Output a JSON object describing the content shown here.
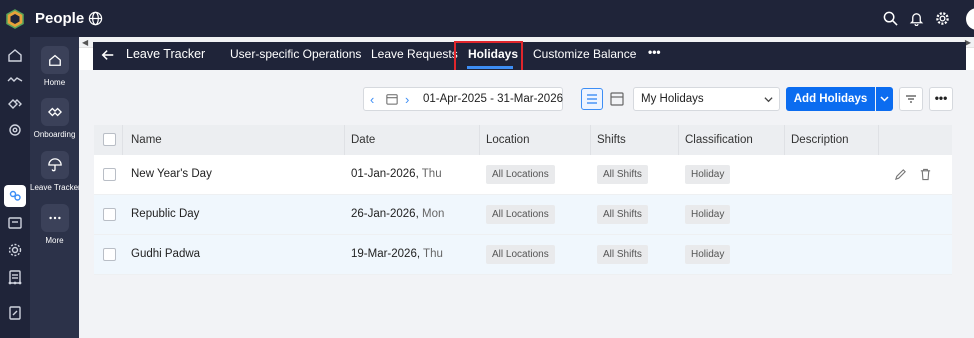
{
  "app": {
    "title": "People"
  },
  "sidebar": {
    "items": [
      {
        "label": "Home",
        "icon": "home-icon"
      },
      {
        "label": "Onboarding",
        "icon": "handshake-icon"
      },
      {
        "label": "Leave Tracker",
        "icon": "umbrella-icon"
      },
      {
        "label": "More",
        "icon": "more-icon"
      }
    ]
  },
  "nav": {
    "title": "Leave Tracker",
    "tabs": [
      "User-specific Operations",
      "Leave Requests",
      "Holidays",
      "Customize Balance"
    ],
    "active_tab": "Holidays",
    "more": "•••"
  },
  "toolbar": {
    "date_range": "01-Apr-2025 - 31-Mar-2026",
    "view_select": "My Holidays",
    "add_button": "Add Holidays",
    "more": "•••"
  },
  "table": {
    "columns": [
      "Name",
      "Date",
      "Location",
      "Shifts",
      "Classification",
      "Description"
    ],
    "rows": [
      {
        "name": "New Year's Day",
        "date": "01-Jan-2026,",
        "day": "Thu",
        "location": "All Locations",
        "shifts": "All Shifts",
        "classification": "Holiday",
        "description": ""
      },
      {
        "name": "Republic Day",
        "date": "26-Jan-2026,",
        "day": "Mon",
        "location": "All Locations",
        "shifts": "All Shifts",
        "classification": "Holiday",
        "description": ""
      },
      {
        "name": "Gudhi Padwa",
        "date": "19-Mar-2026,",
        "day": "Thu",
        "location": "All Locations",
        "shifts": "All Shifts",
        "classification": "Holiday",
        "description": ""
      }
    ]
  },
  "colors": {
    "accent": "#0b6cf0",
    "nav_bg": "#1f2439",
    "highlight_box": "#e0262c"
  }
}
